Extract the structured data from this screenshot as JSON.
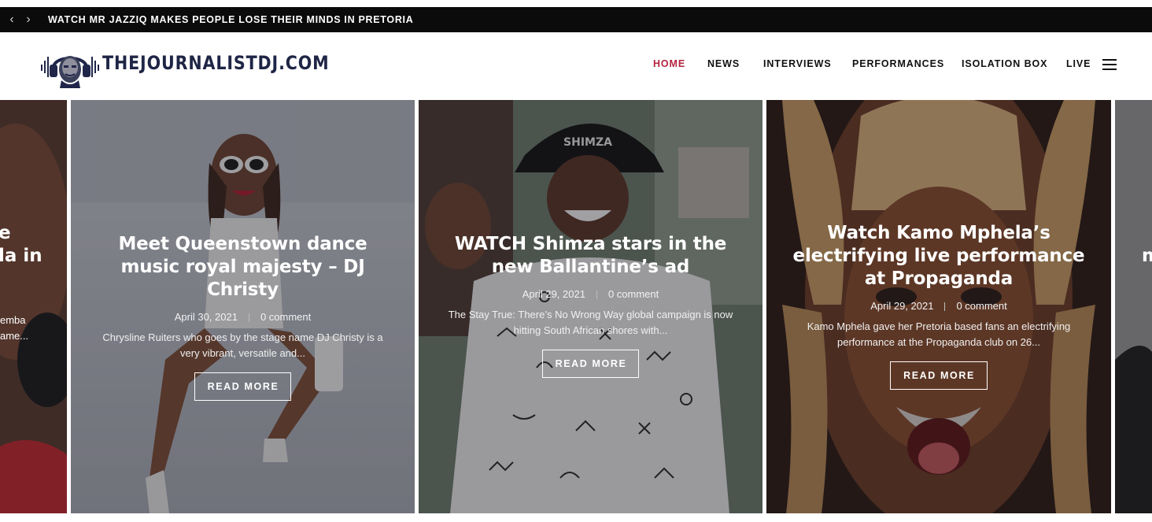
{
  "ticker": {
    "prev_icon": "chevron-left-icon",
    "next_icon": "chevron-right-icon",
    "prev_glyph": "‹",
    "next_glyph": "›",
    "headline": "WATCH MR JAZZIQ MAKES PEOPLE LOSE THEIR MINDS IN PRETORIA"
  },
  "header": {
    "logo_text": "THEJOURNALISTDJ.COM",
    "nav": [
      {
        "label": "HOME",
        "active": true
      },
      {
        "label": "NEWS",
        "active": false
      },
      {
        "label": "INTERVIEWS",
        "active": false
      },
      {
        "label": "PERFORMANCES",
        "active": false
      },
      {
        "label": "ISOLATION BOX",
        "active": false
      },
      {
        "label": "LIVE",
        "active": false
      }
    ],
    "menu_icon": "hamburger-menu-icon",
    "accent_color": "#b3243f"
  },
  "slider": {
    "left_partial": {
      "title_fragments": [
        "e",
        "la in"
      ],
      "excerpt_fragments": [
        "emba",
        "ame..."
      ]
    },
    "right_partial": {
      "title_fragments": [
        "m"
      ]
    },
    "slides": [
      {
        "title": "Meet Queenstown dance music royal majesty – DJ Christy",
        "date": "April 30, 2021",
        "comments": "0 comment",
        "excerpt": "Chrysline Ruiters who goes by the stage name DJ Christy is a very vibrant, versatile and...",
        "button": "READ MORE"
      },
      {
        "title": "WATCH Shimza stars in the new Ballantine’s ad",
        "date": "April 29, 2021",
        "comments": "0 comment",
        "excerpt": "The Stay True: There’s No Wrong Way global campaign is now hitting South African shores with...",
        "button": "READ MORE",
        "hat_text": "SHIMZA"
      },
      {
        "title": "Watch Kamo Mphela’s electrifying live performance at Propaganda",
        "date": "April 29, 2021",
        "comments": "0 comment",
        "excerpt": "Kamo Mphela gave her Pretoria based fans an electrifying performance at the Propaganda club on 26...",
        "button": "READ MORE"
      }
    ]
  }
}
